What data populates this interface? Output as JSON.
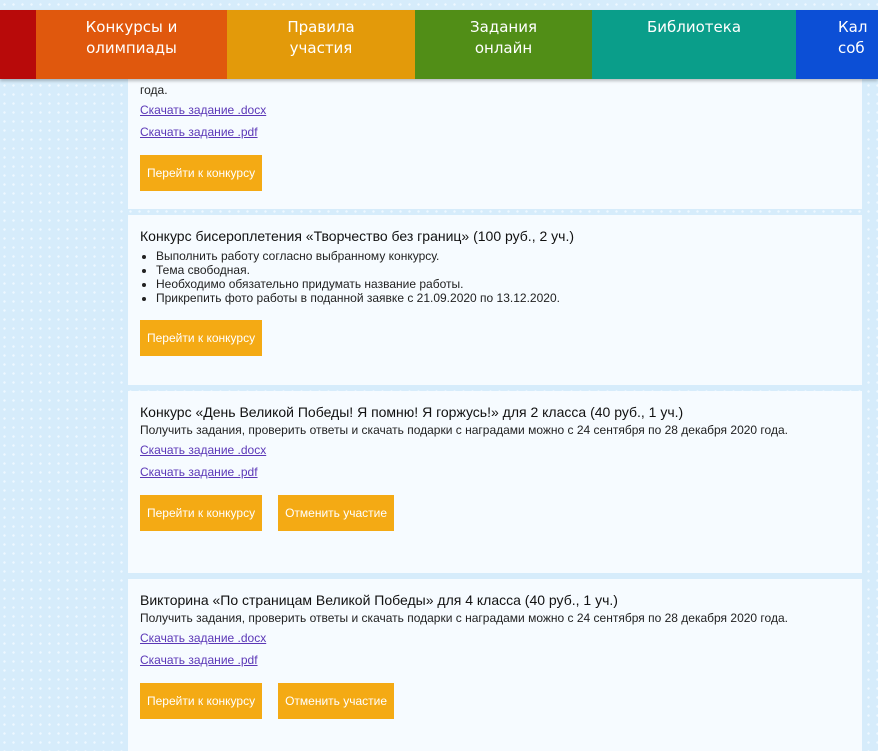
{
  "nav": {
    "items": [
      {
        "label": "",
        "color": "#b80a0a"
      },
      {
        "label": "Конкурсы и\nолимпиады",
        "color": "#e0580d"
      },
      {
        "label": "Правила\nучастия",
        "color": "#e39a0a"
      },
      {
        "label": "Задания\nонлайн",
        "color": "#518e17"
      },
      {
        "label": "Библиотека",
        "color": "#0a9e8a"
      },
      {
        "label": "Кал\nсоб",
        "color": "#0c4fd6"
      }
    ]
  },
  "cards": [
    {
      "text": "года.",
      "link_docx": "Скачать задание .docx",
      "link_pdf": "Скачать задание .pdf",
      "btn_go": "Перейти к конкурсу"
    },
    {
      "title": "Конкурс бисероплетения «Творчество без границ» (100 руб., 2 уч.)",
      "bullets": [
        "Выполнить работу согласно выбранному конкурсу.",
        "Тема свободная.",
        "Необходимо обязательно придумать название работы.",
        "Прикрепить фото работы в поданной заявке с 21.09.2020 по 13.12.2020."
      ],
      "btn_go": "Перейти к конкурсу"
    },
    {
      "title": "Конкурс «День Великой Победы! Я помню! Я горжусь!» для 2 класса (40 руб., 1 уч.)",
      "text": "Получить задания, проверить ответы и скачать подарки с наградами можно с 24 сентября по 28 декабря 2020 года.",
      "link_docx": "Скачать задание .docx",
      "link_pdf": "Скачать задание .pdf",
      "btn_go": "Перейти к конкурсу",
      "btn_cancel": "Отменить участие"
    },
    {
      "title": "Викторина «По страницам Великой Победы» для 4 класса (40 руб., 1 уч.)",
      "text": "Получить задания, проверить ответы и скачать подарки с наградами можно с 24 сентября по 28 декабря 2020 года.",
      "link_docx": "Скачать задание .docx",
      "link_pdf": "Скачать задание .pdf",
      "btn_go": "Перейти к конкурсу",
      "btn_cancel": "Отменить участие"
    }
  ],
  "colors": {
    "button": "#f4aa14",
    "link": "#5b37b7",
    "page_background": "#d6ecfb"
  }
}
